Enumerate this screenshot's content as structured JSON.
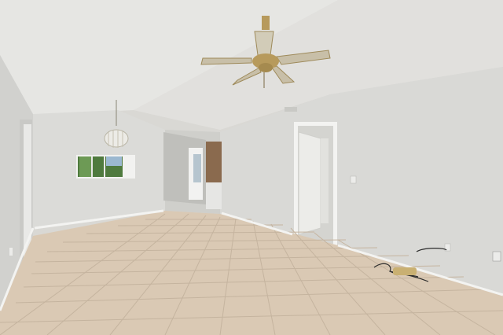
{
  "scene": {
    "kind": "photo",
    "elements": [
      "ceiling-fan-icon",
      "chandelier-icon",
      "window",
      "doorway",
      "open-door",
      "tile-floor",
      "floor-cable",
      "hallway"
    ]
  },
  "colors": {
    "ceiling": "#e6e6e3",
    "ceiling_shadow": "#cfcfcb",
    "wall_left": "#d3d3d0",
    "wall_right": "#d8d8d5",
    "wall_back": "#dadad7",
    "floor": "#d9c9b5",
    "floor_grout": "#c3b39f",
    "baseboard": "#f3f3f1",
    "door": "#eeeeeb",
    "fan_brass": "#b79a5c",
    "fan_blade": "#c8bfa8"
  }
}
